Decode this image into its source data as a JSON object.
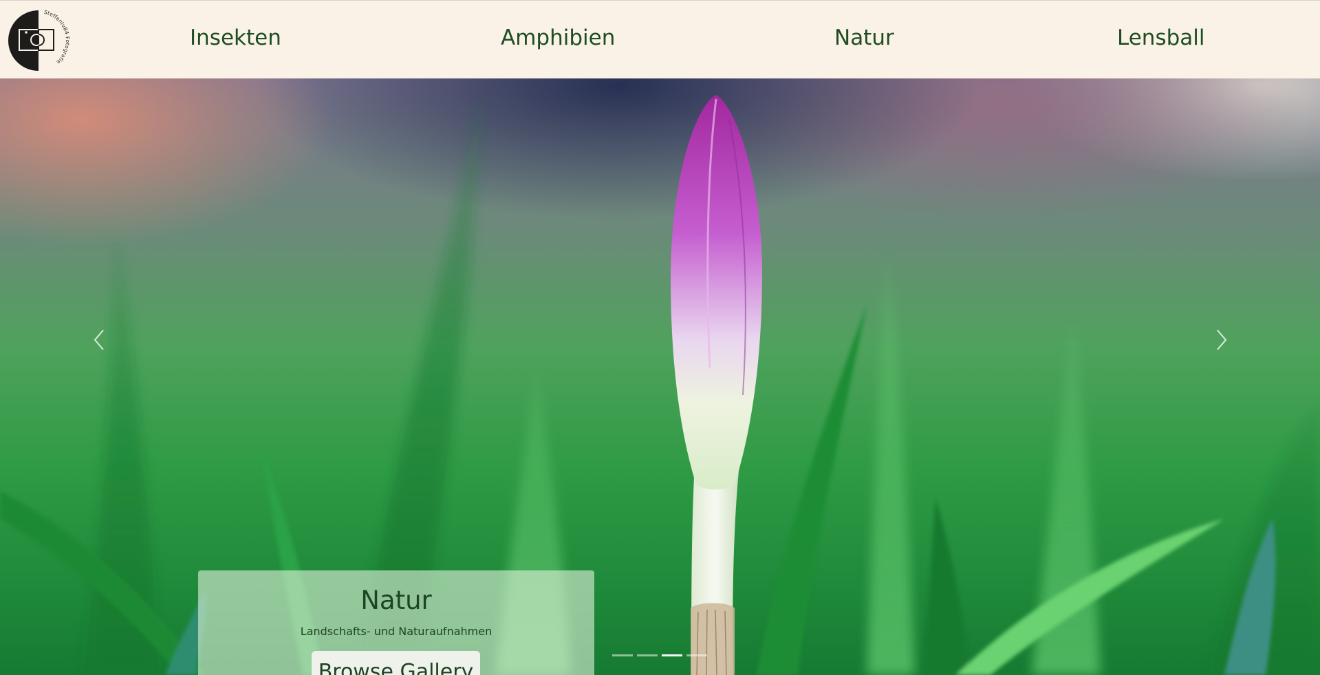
{
  "logo": {
    "text": "Steffenlu84 Fotografie",
    "icon": "camera-icon"
  },
  "nav": {
    "items": [
      {
        "label": "Insekten"
      },
      {
        "label": "Amphibien"
      },
      {
        "label": "Natur"
      },
      {
        "label": "Lensball"
      }
    ]
  },
  "carousel": {
    "slide_title": "Natur",
    "slide_subtitle": "Landschafts- und Naturaufnahmen",
    "button_label": "Browse Gallery",
    "prev_icon": "chevron-left-icon",
    "next_icon": "chevron-right-icon",
    "slide_count": 4,
    "active_index": 2
  },
  "colors": {
    "header_bg": "#faf2e6",
    "nav_text": "#1e4d23",
    "flower": "#b23fc9",
    "grass": "#2f9b45"
  }
}
